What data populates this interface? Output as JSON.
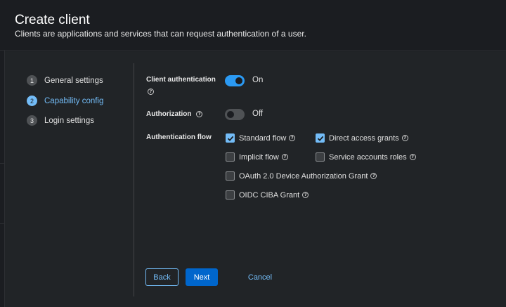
{
  "header": {
    "title": "Create client",
    "subtitle": "Clients are applications and services that can request authentication of a user."
  },
  "steps": [
    {
      "num": "1",
      "label": "General settings",
      "active": false
    },
    {
      "num": "2",
      "label": "Capability config",
      "active": true
    },
    {
      "num": "3",
      "label": "Login settings",
      "active": false
    }
  ],
  "form": {
    "client_auth": {
      "label": "Client authentication",
      "state": "On",
      "enabled": true
    },
    "authorization": {
      "label": "Authorization",
      "state": "Off",
      "enabled": false
    },
    "auth_flow": {
      "label": "Authentication flow",
      "options": [
        {
          "label": "Standard flow",
          "checked": true
        },
        {
          "label": "Direct access grants",
          "checked": true
        },
        {
          "label": "Implicit flow",
          "checked": false
        },
        {
          "label": "Service accounts roles",
          "checked": false
        },
        {
          "label": "OAuth 2.0 Device Authorization Grant",
          "checked": false
        },
        {
          "label": "OIDC CIBA Grant",
          "checked": false
        }
      ]
    },
    "help_glyph": "?"
  },
  "footer": {
    "back_label": "Back",
    "next_label": "Next",
    "cancel_label": "Cancel"
  },
  "colors": {
    "accent": "#73bcf7",
    "primary_button": "#0066cc",
    "toggle_on": "#2b9af3",
    "background": "#1b1d21"
  }
}
